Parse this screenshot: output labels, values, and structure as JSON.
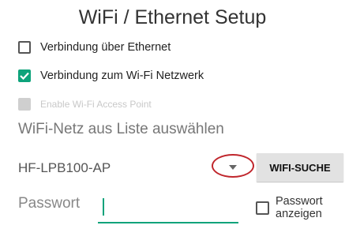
{
  "title": "WiFi / Ethernet Setup",
  "options": {
    "ethernet": {
      "label": "Verbindung über Ethernet",
      "checked": false
    },
    "wifi": {
      "label": "Verbindung zum Wi-Fi Netzwerk",
      "checked": true
    },
    "access_point": {
      "label": "Enable Wi-Fi Access Point",
      "checked": false,
      "disabled": true
    }
  },
  "network": {
    "section_label": "WiFi-Netz aus Liste auswählen",
    "selected_ssid": "HF-LPB100-AP",
    "search_button": "WIFI-SUCHE"
  },
  "password": {
    "label": "Passwort",
    "value": "",
    "show_label": "Passwort anzeigen",
    "show_checked": false
  },
  "colors": {
    "accent": "#0ea37b",
    "highlight_circle": "#c0262c"
  }
}
